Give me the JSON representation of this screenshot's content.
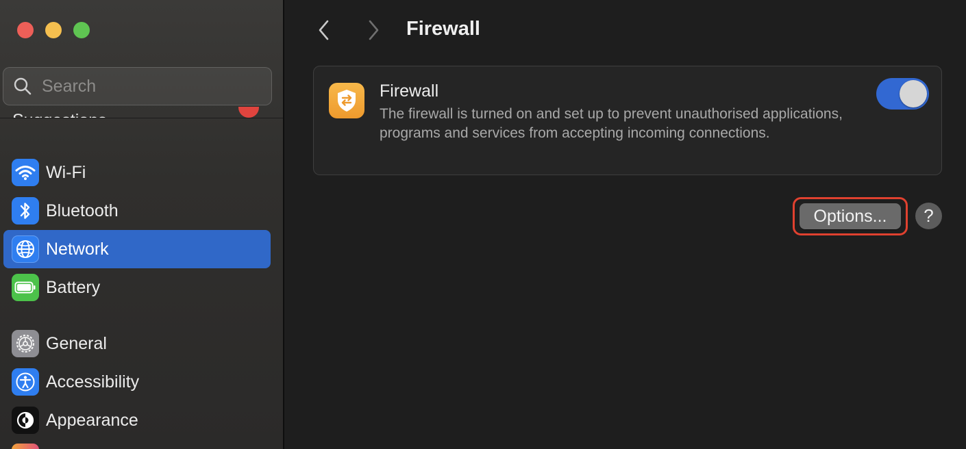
{
  "window": {
    "traffic_lights": [
      "close",
      "minimize",
      "zoom"
    ],
    "colors": {
      "close": "#ed5f58",
      "minimize": "#f5bf4f",
      "zoom": "#5fc452",
      "accent": "#3068c8"
    }
  },
  "sidebar": {
    "search_placeholder": "Search",
    "suggestions_label": "Suggestions",
    "items": [
      {
        "label": "Wi-Fi",
        "icon": "wifi-icon"
      },
      {
        "label": "Bluetooth",
        "icon": "bluetooth-icon"
      },
      {
        "label": "Network",
        "icon": "globe-icon",
        "selected": true
      },
      {
        "label": "Battery",
        "icon": "battery-icon"
      },
      {
        "label": "General",
        "icon": "gear-icon"
      },
      {
        "label": "Accessibility",
        "icon": "accessibility-icon"
      },
      {
        "label": "Appearance",
        "icon": "appearance-icon"
      }
    ]
  },
  "header": {
    "back_icon": "chevron-left-icon",
    "forward_icon": "chevron-right-icon",
    "title": "Firewall"
  },
  "firewall_card": {
    "icon": "firewall-shield-icon",
    "title": "Firewall",
    "description": "The firewall is turned on and set up to prevent unauthorised applications, programs and services from accepting incoming connections.",
    "enabled": true
  },
  "actions": {
    "options_label": "Options...",
    "help_label": "?"
  }
}
